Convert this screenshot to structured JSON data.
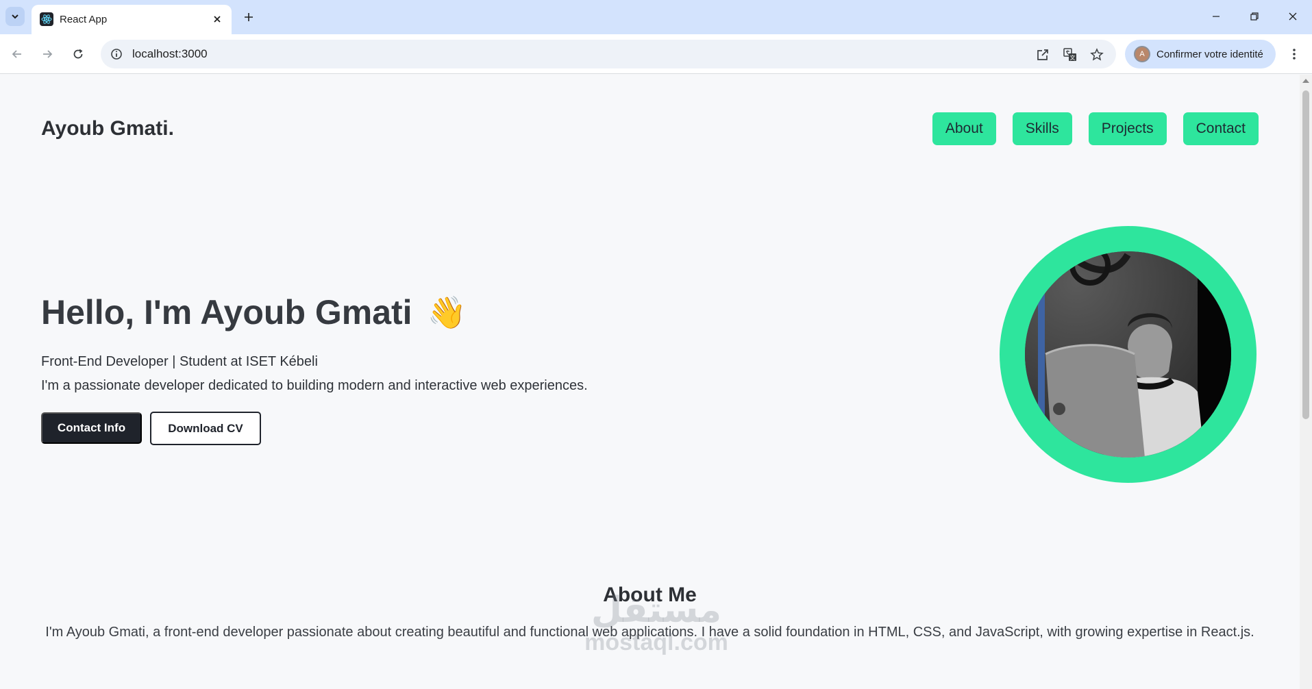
{
  "browser": {
    "tab_title": "React App",
    "url": "localhost:3000",
    "profile_label": "Confirmer votre identité",
    "profile_initial": "A"
  },
  "site": {
    "brand": "Ayoub Gmati.",
    "nav": [
      "About",
      "Skills",
      "Projects",
      "Contact"
    ]
  },
  "hero": {
    "title": "Hello, I'm Ayoub Gmati",
    "emoji": "👋",
    "subtitle": "Front-End Developer | Student at ISET Kébeli",
    "description": "I'm a passionate developer dedicated to building modern and interactive web experiences.",
    "contact_button": "Contact Info",
    "cv_button": "Download CV"
  },
  "about": {
    "title": "About Me",
    "text": "I'm Ayoub Gmati, a front-end developer passionate about creating beautiful and functional web applications. I have a solid foundation in HTML, CSS, and JavaScript, with growing expertise in React.js."
  },
  "watermark": {
    "arabic": "مستقل",
    "latin": "mostaql.com"
  },
  "colors": {
    "accent": "#2ee59d",
    "dark": "#1f232b",
    "page_bg": "#f7f8fa",
    "chrome_bg": "#d3e3fd"
  }
}
